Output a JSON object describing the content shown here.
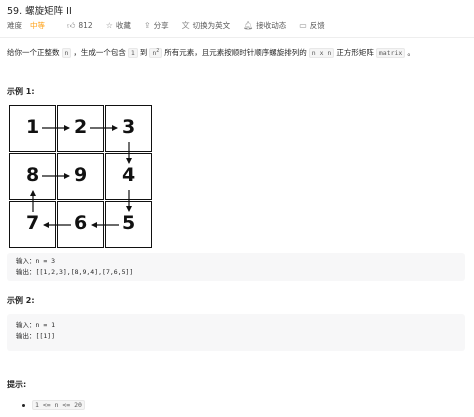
{
  "problem": {
    "title": "59. 螺旋矩阵 II"
  },
  "meta": {
    "difficulty_label": "难度",
    "difficulty": "中等",
    "likes": "812",
    "favorite": "收藏",
    "share": "分享",
    "switch_lang": "切换为英文",
    "notify": "接收动态",
    "feedback": "反馈"
  },
  "description": {
    "part1": "给你一个正整数",
    "code_n": "n",
    "part2": "，生成一个包含",
    "code_1": "1",
    "part3": "到",
    "code_n2_base": "n",
    "code_n2_exp": "2",
    "part4": "所有元素，且元素按顺时针顺序螺旋排列的",
    "code_nxn": "n x n",
    "part5": "正方形矩阵",
    "code_matrix": "matrix",
    "part6": "。"
  },
  "example1": {
    "heading": "示例 1:",
    "grid": [
      [
        "1",
        "2",
        "3"
      ],
      [
        "8",
        "9",
        "4"
      ],
      [
        "7",
        "6",
        "5"
      ]
    ],
    "input": "输入：n = 3",
    "output": "输出：[[1,2,3],[8,9,4],[7,6,5]]"
  },
  "example2": {
    "heading": "示例 2:",
    "input": "输入：n = 1",
    "output": "输出：[[1]]"
  },
  "hints": {
    "heading": "提示:",
    "constraint": "1 <= n <= 20"
  }
}
